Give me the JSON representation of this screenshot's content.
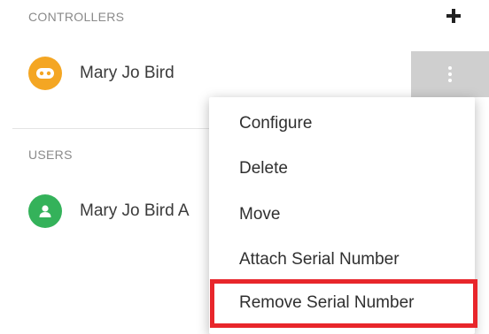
{
  "controllers": {
    "header": "CONTROLLERS",
    "items": [
      {
        "name": "Mary Jo Bird",
        "icon": "controller-icon"
      }
    ]
  },
  "users": {
    "header": "USERS",
    "items": [
      {
        "name": "Mary Jo Bird A",
        "icon": "user-icon"
      }
    ]
  },
  "context_menu": {
    "items": [
      {
        "label": "Configure"
      },
      {
        "label": "Delete"
      },
      {
        "label": "Move"
      },
      {
        "label": "Attach Serial Number"
      },
      {
        "label": "Remove Serial Number",
        "highlighted": true
      }
    ]
  },
  "colors": {
    "controller_avatar": "#f4a623",
    "user_avatar": "#34b25a",
    "highlight": "#e8262b"
  }
}
